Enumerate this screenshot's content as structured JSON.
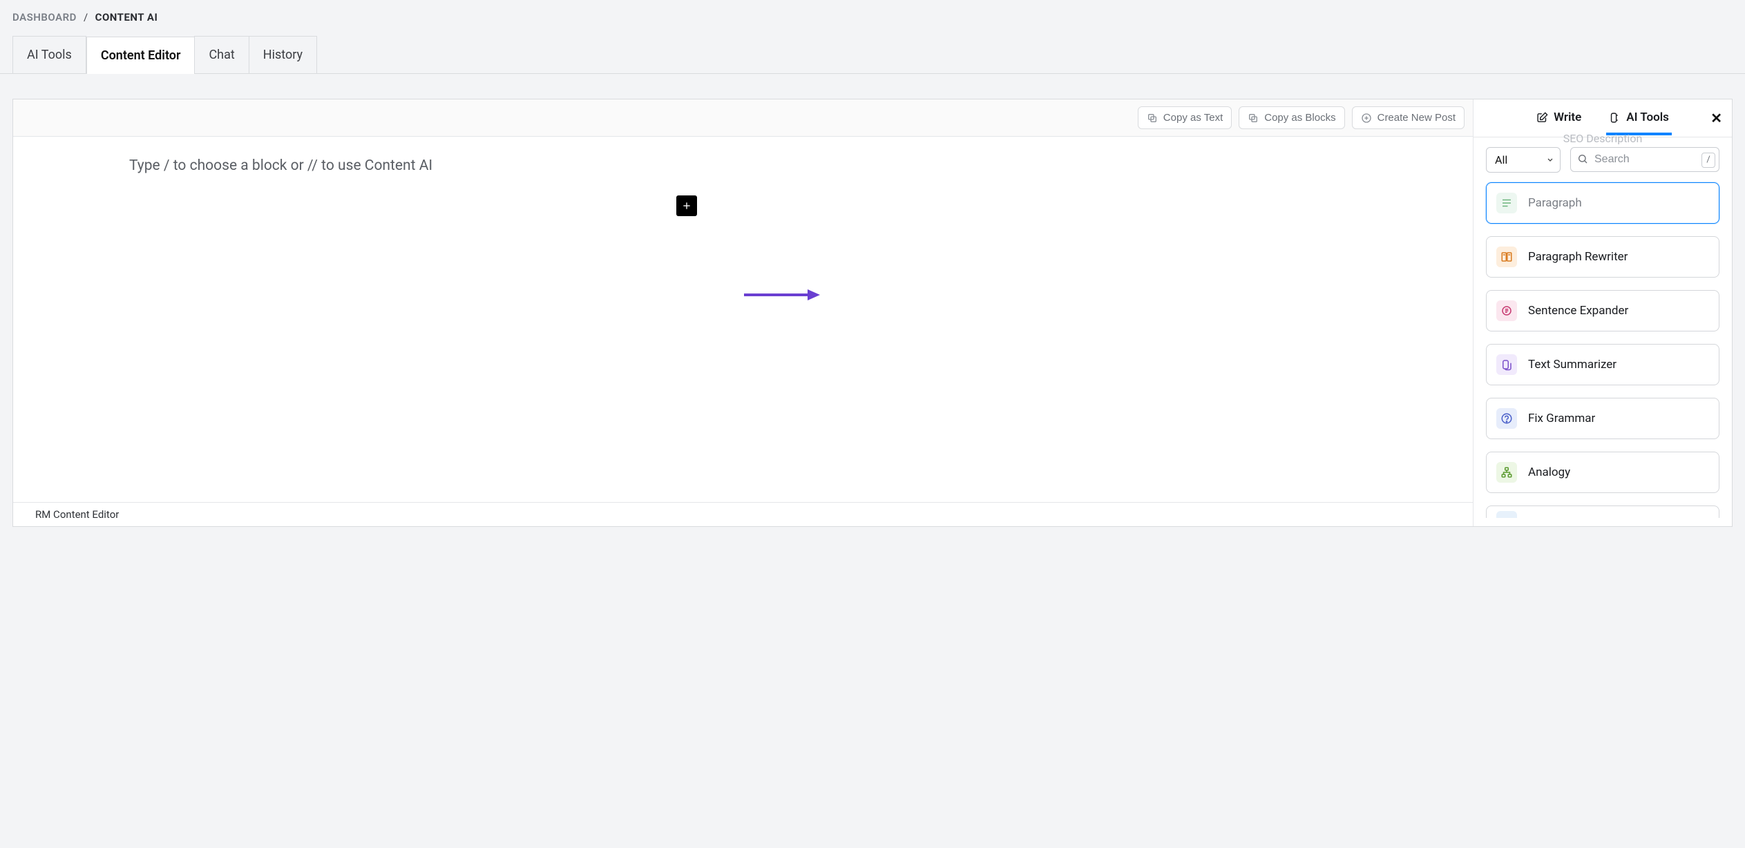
{
  "breadcrumb": {
    "dashboard": "DASHBOARD",
    "separator": "/",
    "current": "CONTENT AI"
  },
  "tabs": {
    "ai_tools": "AI Tools",
    "content_editor": "Content Editor",
    "chat": "Chat",
    "history": "History"
  },
  "toolbar": {
    "copy_text": "Copy as Text",
    "copy_blocks": "Copy as Blocks",
    "create_post": "Create New Post"
  },
  "editor": {
    "placeholder": "Type / to choose a block or // to use Content AI",
    "footer": "RM Content Editor"
  },
  "sidebar": {
    "tab_write": "Write",
    "tab_aitools": "AI Tools",
    "ghost": "SEO Description",
    "filter_select": "All",
    "search_placeholder": "Search",
    "slash_hint": "/",
    "tools": [
      {
        "label": "Paragraph"
      },
      {
        "label": "Paragraph Rewriter"
      },
      {
        "label": "Sentence Expander"
      },
      {
        "label": "Text Summarizer"
      },
      {
        "label": "Fix Grammar"
      },
      {
        "label": "Analogy"
      }
    ]
  }
}
